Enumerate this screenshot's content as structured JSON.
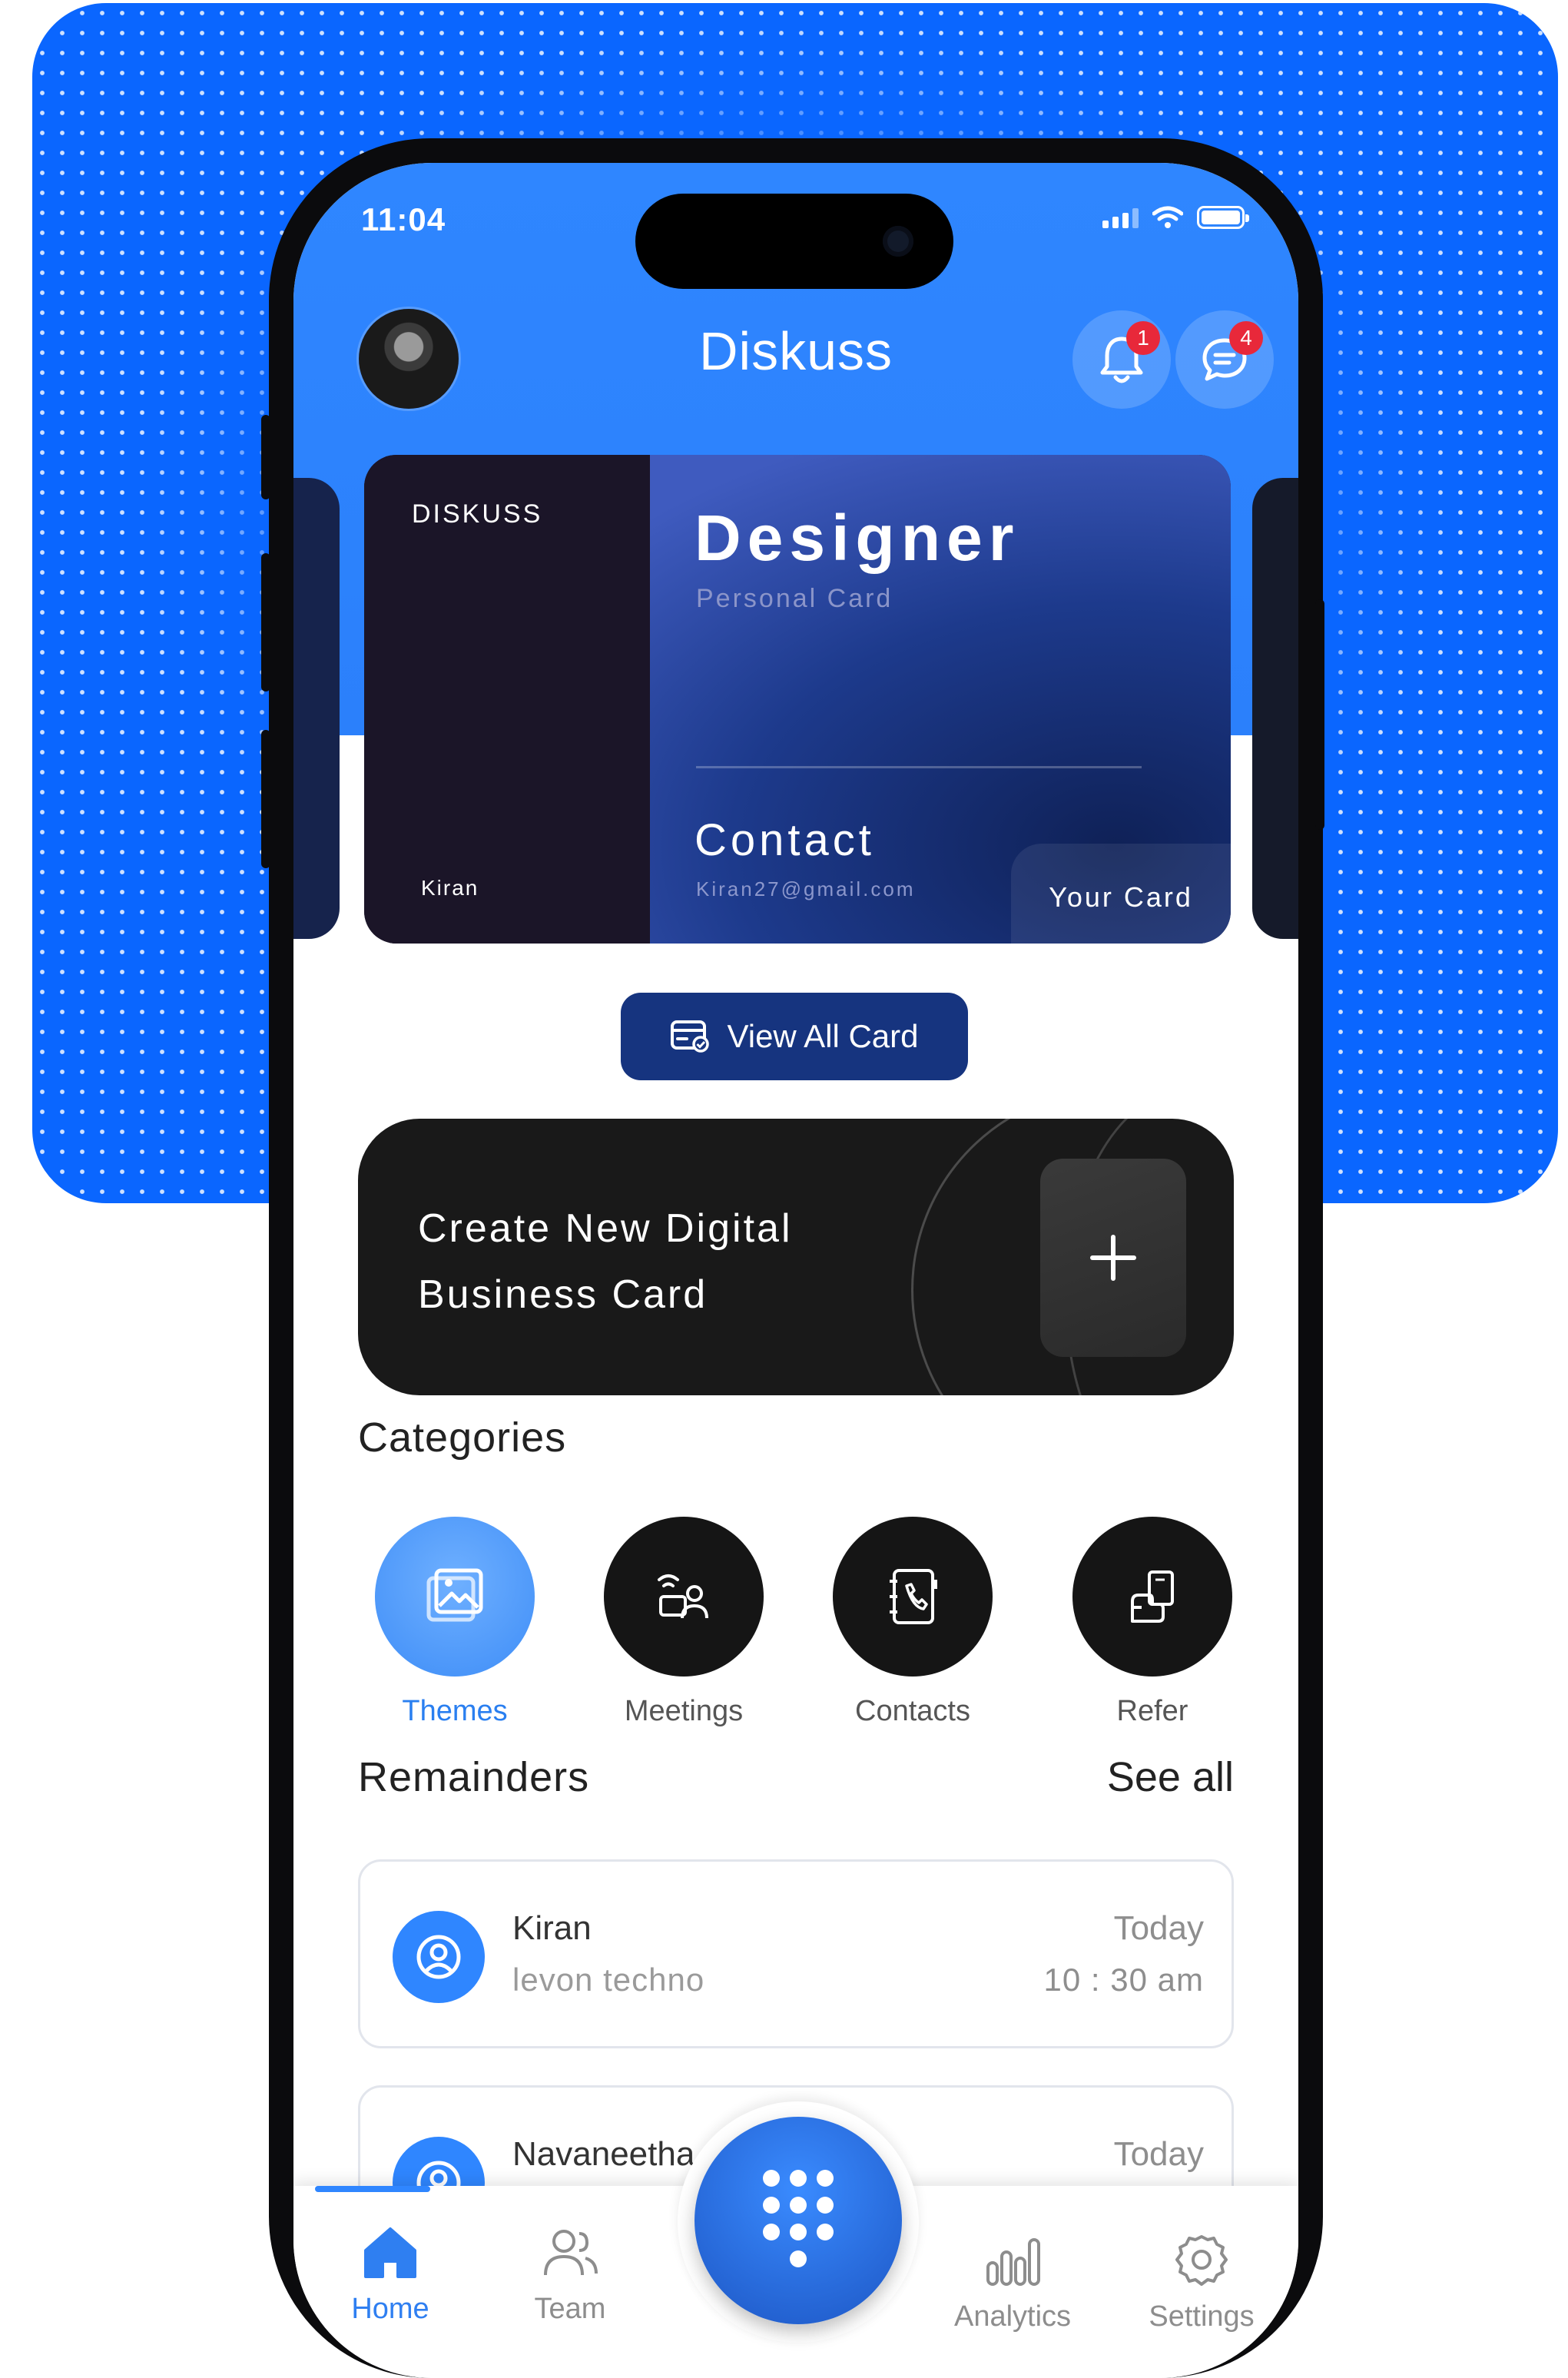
{
  "status_bar": {
    "time": "11:04"
  },
  "header": {
    "app_title": "Diskuss",
    "notification_count": "1",
    "message_count": "4"
  },
  "card": {
    "brand": "DISKUSS",
    "owner": "Kiran",
    "role": "Designer",
    "role_subtitle": "Personal Card",
    "contact_label": "Contact",
    "email": "Kiran27@gmail.com",
    "your_card_label": "Your Card"
  },
  "view_all_button": "View All Card",
  "create_card": {
    "line1": "Create New Digital",
    "line2": "Business Card"
  },
  "categories": {
    "title": "Categories",
    "items": [
      {
        "label": "Themes",
        "icon": "image-gallery-icon",
        "active": true
      },
      {
        "label": "Meetings",
        "icon": "meeting-icon",
        "active": false
      },
      {
        "label": "Contacts",
        "icon": "contact-book-icon",
        "active": false
      },
      {
        "label": "Refer",
        "icon": "refer-icon",
        "active": false
      }
    ]
  },
  "reminders": {
    "title": "Remainders",
    "see_all": "See all",
    "items": [
      {
        "name": "Kiran",
        "org": "levon techno",
        "day": "Today",
        "time": "10 : 30 am"
      },
      {
        "name": "Navaneetha",
        "org": "",
        "day": "Today",
        "time": ""
      }
    ]
  },
  "tabs": [
    {
      "label": "Home",
      "icon": "home-icon",
      "active": true
    },
    {
      "label": "Team",
      "icon": "team-icon",
      "active": false
    },
    {
      "label": "Analytics",
      "icon": "analytics-icon",
      "active": false
    },
    {
      "label": "Settings",
      "icon": "settings-icon",
      "active": false
    }
  ],
  "colors": {
    "primary": "#2f86ff",
    "background_panel": "#0a66ff",
    "dark": "#191919",
    "badge": "#e8283a"
  }
}
